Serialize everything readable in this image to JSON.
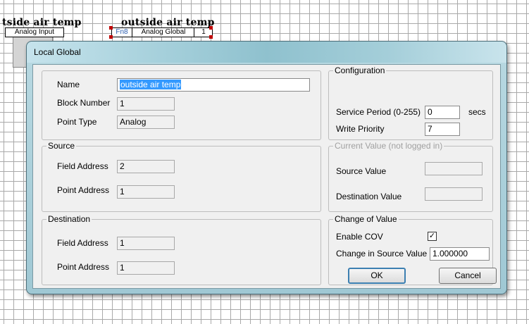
{
  "canvas": {
    "block1": {
      "title": "tside air temp",
      "type_label": "Analog Input"
    },
    "block2": {
      "title": "outside air temp",
      "fn": "Fn8",
      "type_label": "Analog Global",
      "index": "1"
    }
  },
  "dialog": {
    "title": "Local Global",
    "name": {
      "label": "Name",
      "value": "outside air temp"
    },
    "block_number": {
      "label": "Block Number",
      "value": "1"
    },
    "point_type": {
      "label": "Point Type",
      "value": "Analog"
    },
    "source": {
      "group": "Source",
      "field_address": {
        "label": "Field Address",
        "value": "2"
      },
      "point_address": {
        "label": "Point Address",
        "value": "1"
      }
    },
    "destination": {
      "group": "Destination",
      "field_address": {
        "label": "Field Address",
        "value": "1"
      },
      "point_address": {
        "label": "Point Address",
        "value": "1"
      }
    },
    "configuration": {
      "group": "Configuration",
      "service_period": {
        "label": "Service Period (0-255)",
        "value": "0",
        "unit": "secs"
      },
      "write_priority": {
        "label": "Write Priority",
        "value": "7"
      }
    },
    "current_value": {
      "group": "Current Value (not logged in)",
      "source_value": {
        "label": "Source Value",
        "value": ""
      },
      "destination_value": {
        "label": "Destination Value",
        "value": ""
      }
    },
    "change_of_value": {
      "group": "Change of Value",
      "enable_cov": {
        "label": "Enable COV",
        "checked": true,
        "mark": "✓"
      },
      "change_in_source": {
        "label": "Change in Source Value",
        "value": "1.000000"
      }
    },
    "buttons": {
      "ok": "OK",
      "cancel": "Cancel"
    }
  }
}
